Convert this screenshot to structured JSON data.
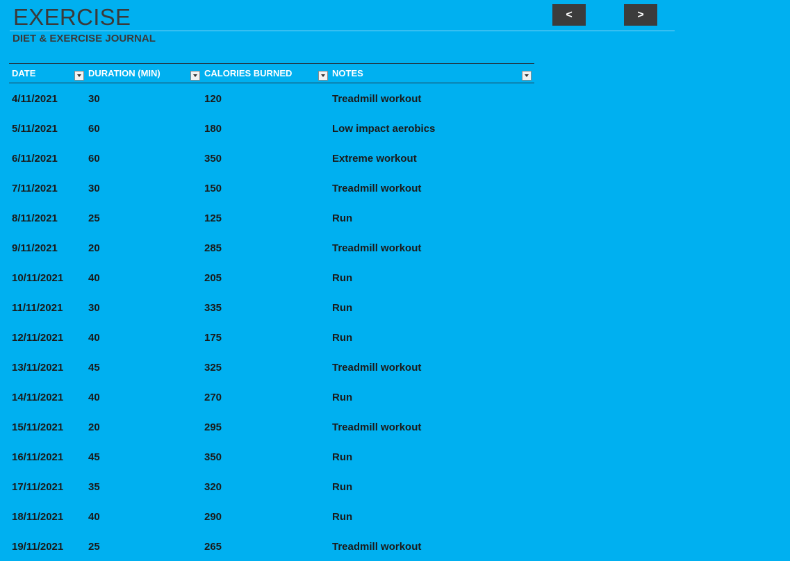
{
  "header": {
    "title": "EXERCISE",
    "subtitle": "DIET & EXERCISE JOURNAL"
  },
  "nav": {
    "prev_label": "<",
    "next_label": ">"
  },
  "table": {
    "columns": [
      "DATE",
      "DURATION (MIN)",
      "CALORIES BURNED",
      "NOTES"
    ],
    "rows": [
      [
        "4/11/2021",
        "30",
        "120",
        "Treadmill workout"
      ],
      [
        "5/11/2021",
        "60",
        "180",
        "Low impact aerobics"
      ],
      [
        "6/11/2021",
        "60",
        "350",
        "Extreme workout"
      ],
      [
        "7/11/2021",
        "30",
        "150",
        "Treadmill workout"
      ],
      [
        "8/11/2021",
        "25",
        "125",
        "Run"
      ],
      [
        "9/11/2021",
        "20",
        "285",
        "Treadmill workout"
      ],
      [
        "10/11/2021",
        "40",
        "205",
        "Run"
      ],
      [
        "11/11/2021",
        "30",
        "335",
        "Run"
      ],
      [
        "12/11/2021",
        "40",
        "175",
        "Run"
      ],
      [
        "13/11/2021",
        "45",
        "325",
        "Treadmill workout"
      ],
      [
        "14/11/2021",
        "40",
        "270",
        "Run"
      ],
      [
        "15/11/2021",
        "20",
        "295",
        "Treadmill workout"
      ],
      [
        "16/11/2021",
        "45",
        "350",
        "Run"
      ],
      [
        "17/11/2021",
        "35",
        "320",
        "Run"
      ],
      [
        "18/11/2021",
        "40",
        "290",
        "Run"
      ],
      [
        "19/11/2021",
        "25",
        "265",
        "Treadmill workout"
      ]
    ]
  },
  "colors": {
    "background": "#00B0F0",
    "title_text": "#3A3A3A",
    "header_text": "#FFFFFF",
    "cell_text": "#1A1A1A",
    "nav_button": "#3C3C3C"
  },
  "icons": {
    "filter": "dropdown-arrow-icon"
  }
}
